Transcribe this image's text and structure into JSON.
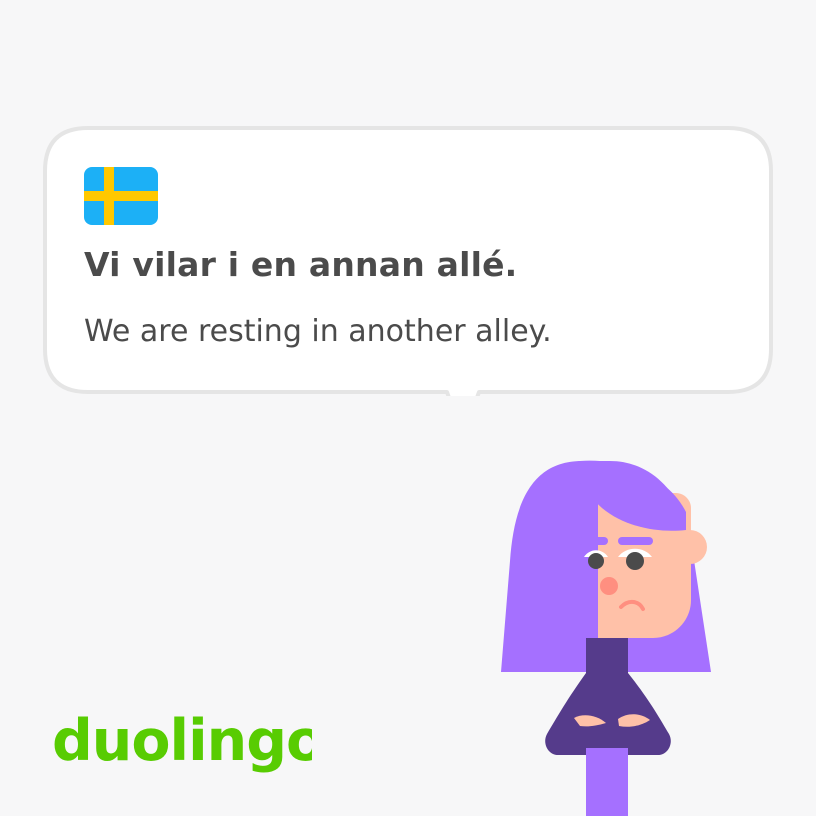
{
  "phrase": {
    "text": "Vi vilar i en annan allé.",
    "translation": "We are resting in another alley."
  },
  "logo": {
    "text": "duolingo"
  },
  "icons": {
    "flag": "sweden-flag-icon",
    "character": "lily-character"
  },
  "colors": {
    "background": "#f7f7f8",
    "bubble_fill": "#ffffff",
    "bubble_border": "#e5e5e5",
    "text": "#4b4b4b",
    "brand_green": "#58cc02",
    "flag_blue": "#1cb0f6",
    "flag_yellow": "#ffc800",
    "hair": "#a570ff",
    "shirt": "#553b8b",
    "skin": "#ffc1a8"
  }
}
